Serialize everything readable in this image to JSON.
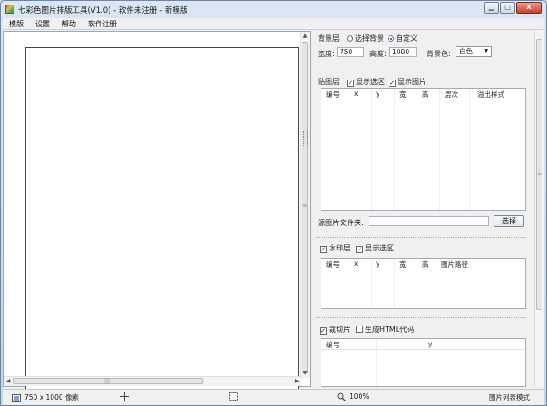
{
  "window": {
    "title": "七彩色图片排版工具(V1.0) - 软件未注册 - 新模版",
    "min_label": "▁",
    "max_label": "□",
    "close_label": "X"
  },
  "menu": [
    "模版",
    "设置",
    "帮助",
    "软件注册"
  ],
  "background": {
    "label": "背景层:",
    "option_select": "选择背景",
    "option_custom": "自定义",
    "selected": "自定义",
    "width_label": "宽度:",
    "width_value": "750",
    "height_label": "高度:",
    "height_value": "1000",
    "color_label": "背景色:",
    "color_value": "白色"
  },
  "paste_layer": {
    "label": "贴图层:",
    "show_selection": "显示选区",
    "show_image": "显示图片",
    "columns": [
      "编号",
      "x",
      "y",
      "宽",
      "高",
      "层次",
      "溢出样式"
    ]
  },
  "source_folder": {
    "label": "源图片文件夹:",
    "value": "",
    "button": "选择"
  },
  "watermark": {
    "label": "水印层",
    "show_selection": "显示选区",
    "columns": [
      "编号",
      "x",
      "y",
      "宽",
      "高",
      "图片路径"
    ]
  },
  "slices": {
    "label": "裁切片",
    "html_label": "生成HTML代码",
    "columns": [
      "编号",
      "y"
    ]
  },
  "status": {
    "size": "750 x 1000 像素",
    "zoom": "100%",
    "mode": "图片列表模式"
  },
  "colors": {
    "accent": "#1a4fb8",
    "frame": "#c4d4e8"
  }
}
